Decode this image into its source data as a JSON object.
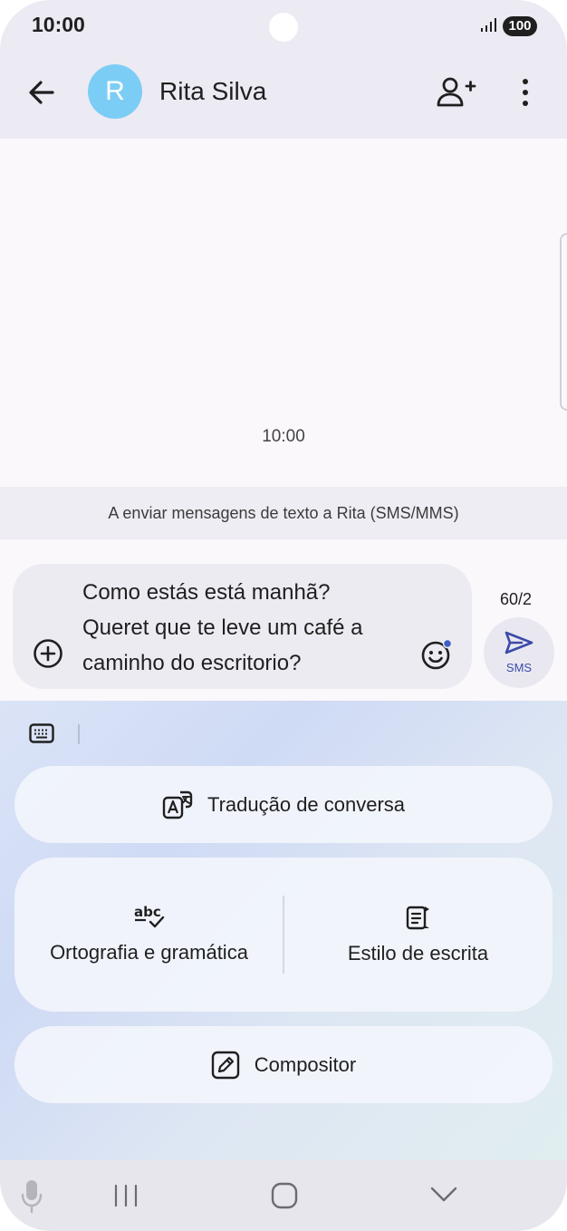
{
  "status_bar": {
    "time": "10:00",
    "battery": "100"
  },
  "header": {
    "contact_initial": "R",
    "contact_name": "Rita Silva"
  },
  "conversation": {
    "timestamp": "10:00",
    "sms_info": "A enviar mensagens de texto a Rita (SMS/MMS)"
  },
  "compose": {
    "lines": [
      "Como estás está manhã?",
      "Queret que te leve um café a",
      "caminho do escritorio?"
    ],
    "char_count": "60/2",
    "send_label": "SMS"
  },
  "ai_panel": {
    "translate_label": "Tradução de conversa",
    "spelling_label": "Ortografia e gramática",
    "style_label": "Estilo de escrita",
    "composer_label": "Compositor"
  },
  "colors": {
    "accent": "#3b4aa8",
    "avatar": "#7ccdf5",
    "header_bg": "#eceaf3"
  }
}
